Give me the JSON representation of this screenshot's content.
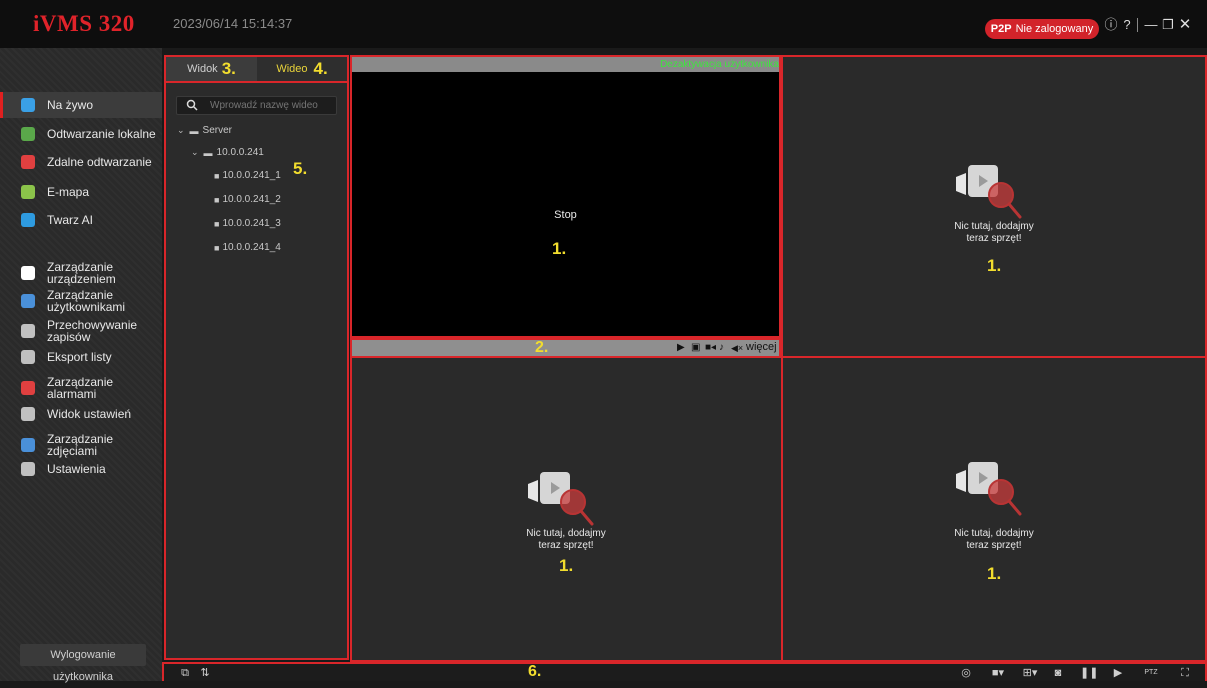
{
  "app": {
    "logo": "iVMS 320",
    "datetime": "2023/06/14 15:14:37",
    "p2p_badge": "P2P",
    "login_status": "Nie zalogowany"
  },
  "sidebar": {
    "items": [
      {
        "label": "Na żywo",
        "icon": "live-view-icon",
        "color": "#3aa0e6",
        "active": true
      },
      {
        "label": "Odtwarzanie lokalne",
        "icon": "local-playback-icon",
        "color": "#5aa84a"
      },
      {
        "label": "Zdalne odtwarzanie",
        "icon": "remote-playback-icon",
        "color": "#e04040"
      },
      {
        "label": "E-mapa",
        "icon": "emap-icon",
        "color": "#8bc34a"
      },
      {
        "label": "Twarz AI",
        "icon": "face-ai-icon",
        "color": "#2e9be0"
      },
      {
        "label": "Zarządzanie urządzeniem",
        "icon": "device-management-icon",
        "color": "#ffffff"
      },
      {
        "label": "Zarządzanie użytkownikami",
        "icon": "user-management-icon",
        "color": "#4a90d9"
      },
      {
        "label": "Przechowywanie zapisów",
        "icon": "storage-icon",
        "color": "#c0c0c0"
      },
      {
        "label": "Eksport listy",
        "icon": "export-list-icon",
        "color": "#c0c0c0"
      },
      {
        "label": "Zarządzanie alarmami",
        "icon": "alarm-icon",
        "color": "#e04040"
      },
      {
        "label": "Widok ustawień",
        "icon": "view-settings-icon",
        "color": "#c0c0c0"
      },
      {
        "label": "Zarządzanie zdjęciami",
        "icon": "photo-management-icon",
        "color": "#4a90d9"
      },
      {
        "label": "Ustawienia",
        "icon": "settings-icon",
        "color": "#c0c0c0"
      }
    ],
    "logout_label": "Wylogowanie użytkownika"
  },
  "device_panel": {
    "tab_view": "Widok",
    "tab_video": "Wideo",
    "search_placeholder": "Wprowadź nazwę wideo",
    "tree": {
      "root": "Server",
      "device": "10.0.0.241",
      "channels": [
        "10.0.0.241_1",
        "10.0.0.241_2",
        "10.0.0.241_3",
        "10.0.0.241_4"
      ]
    }
  },
  "video": {
    "deactivation_label": "Dezaktywacja użytkownika",
    "stop_label": "Stop",
    "empty_line1": "Nic tutaj, dodajmy",
    "empty_line2": "teraz sprzęt!",
    "more_label": "więcej"
  },
  "annotations": {
    "a1": "1.",
    "a2": "2.",
    "a3": "3.",
    "a4": "4.",
    "a5": "5.",
    "a6": "6."
  },
  "colors": {
    "accent": "#e0232a",
    "highlight": "#f2dd2e",
    "status_green": "#3ee63e"
  }
}
